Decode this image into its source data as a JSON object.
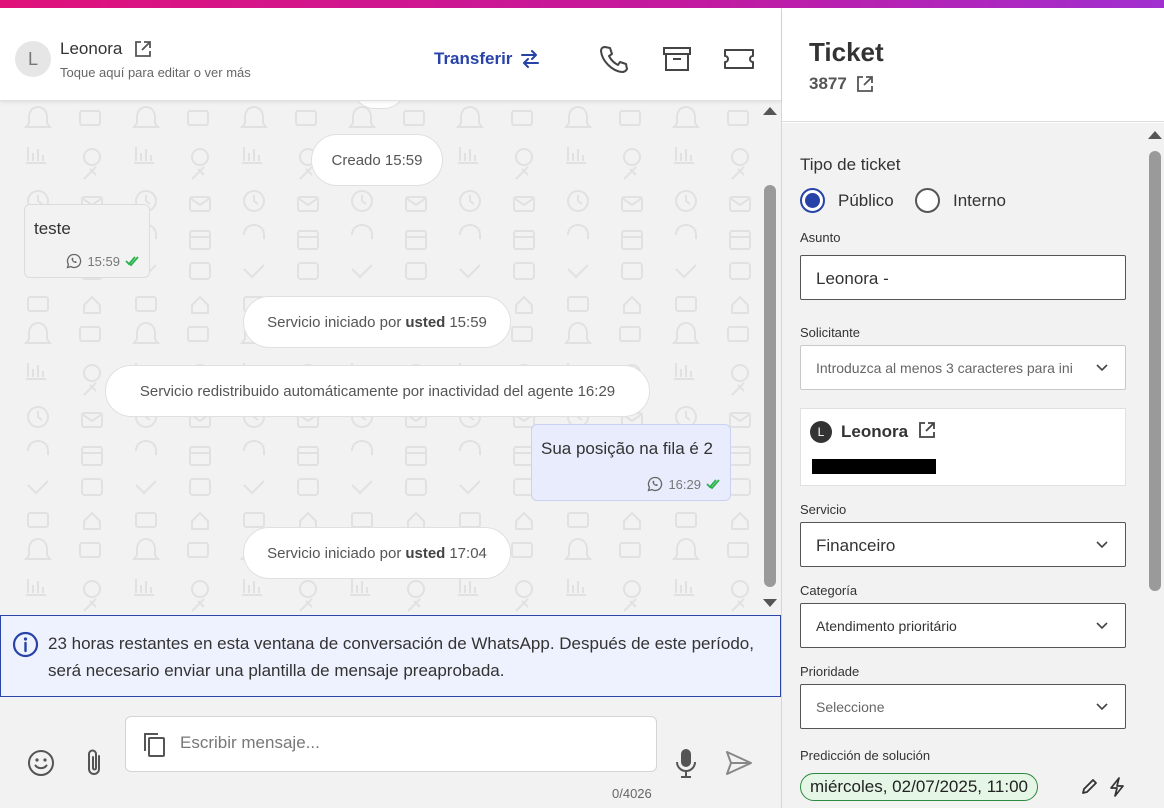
{
  "contact": {
    "avatar_letter": "L",
    "name": "Leonora",
    "subtitle": "Toque aquí para editar o ver más"
  },
  "header": {
    "transfer_label": "Transferir"
  },
  "messages": {
    "created_pill": "Creado 15:59",
    "incoming": {
      "text": "teste",
      "time": "15:59"
    },
    "system_1": {
      "prefix": "Servicio iniciado por",
      "who": "usted",
      "time": "15:59"
    },
    "system_2": "Servicio redistribuido automáticamente por inactividad del agente 16:29",
    "outgoing": {
      "text": "Sua posição na fila é 2",
      "time": "16:29"
    },
    "system_3": {
      "prefix": "Servicio iniciado por",
      "who": "usted",
      "time": "17:04"
    }
  },
  "notice": {
    "text": "23 horas restantes en esta ventana de conversación de WhatsApp. Después de este período, será necesario enviar una plantilla de mensaje preaprobada."
  },
  "composer": {
    "placeholder": "Escribir mensaje...",
    "counter": "0/4026"
  },
  "ticket": {
    "title": "Ticket",
    "number": "3877",
    "type_title": "Tipo de ticket",
    "type_options": [
      "Público",
      "Interno"
    ],
    "type_selected": "Público",
    "subject_label": "Asunto",
    "subject_value": "Leonora  -",
    "requester_label": "Solicitante",
    "requester_placeholder": "Introduzca al menos 3 caracteres para ini",
    "requester_card": {
      "avatar_letter": "L",
      "name": "Leonora"
    },
    "service_label": "Servicio",
    "service_value": "Financeiro",
    "category_label": "Categoría",
    "category_value": "Atendimento prioritário",
    "priority_label": "Prioridade",
    "priority_placeholder": "Seleccione",
    "prediction_label": "Predicción de solución",
    "prediction_value": "miércoles, 02/07/2025, 11:00"
  },
  "colors": {
    "accent": "#2743a8",
    "gradient_start": "#e0127a",
    "gradient_end": "#a12fd0",
    "chip_green": "#2b8a3e",
    "read_check": "#2bb24c"
  }
}
